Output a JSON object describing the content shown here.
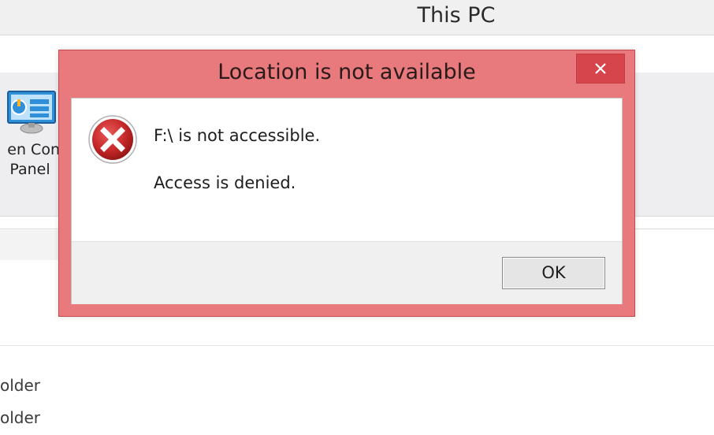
{
  "window": {
    "title": "This PC"
  },
  "ribbon": {
    "control_panel": {
      "label_line_1": "en Con",
      "label_line_2": "Panel",
      "icon": "control-panel-icon"
    }
  },
  "list": {
    "items": [
      "older",
      "older"
    ]
  },
  "dialog": {
    "title": "Location is not available",
    "close_icon": "close-icon",
    "error_icon": "error-icon",
    "message_primary": "F:\\ is not accessible.",
    "message_secondary": "Access is denied.",
    "ok_label": "OK"
  },
  "colors": {
    "dialog_frame": "#e87a7e",
    "close_button": "#d6454b",
    "error_icon_red": "#c62828"
  }
}
